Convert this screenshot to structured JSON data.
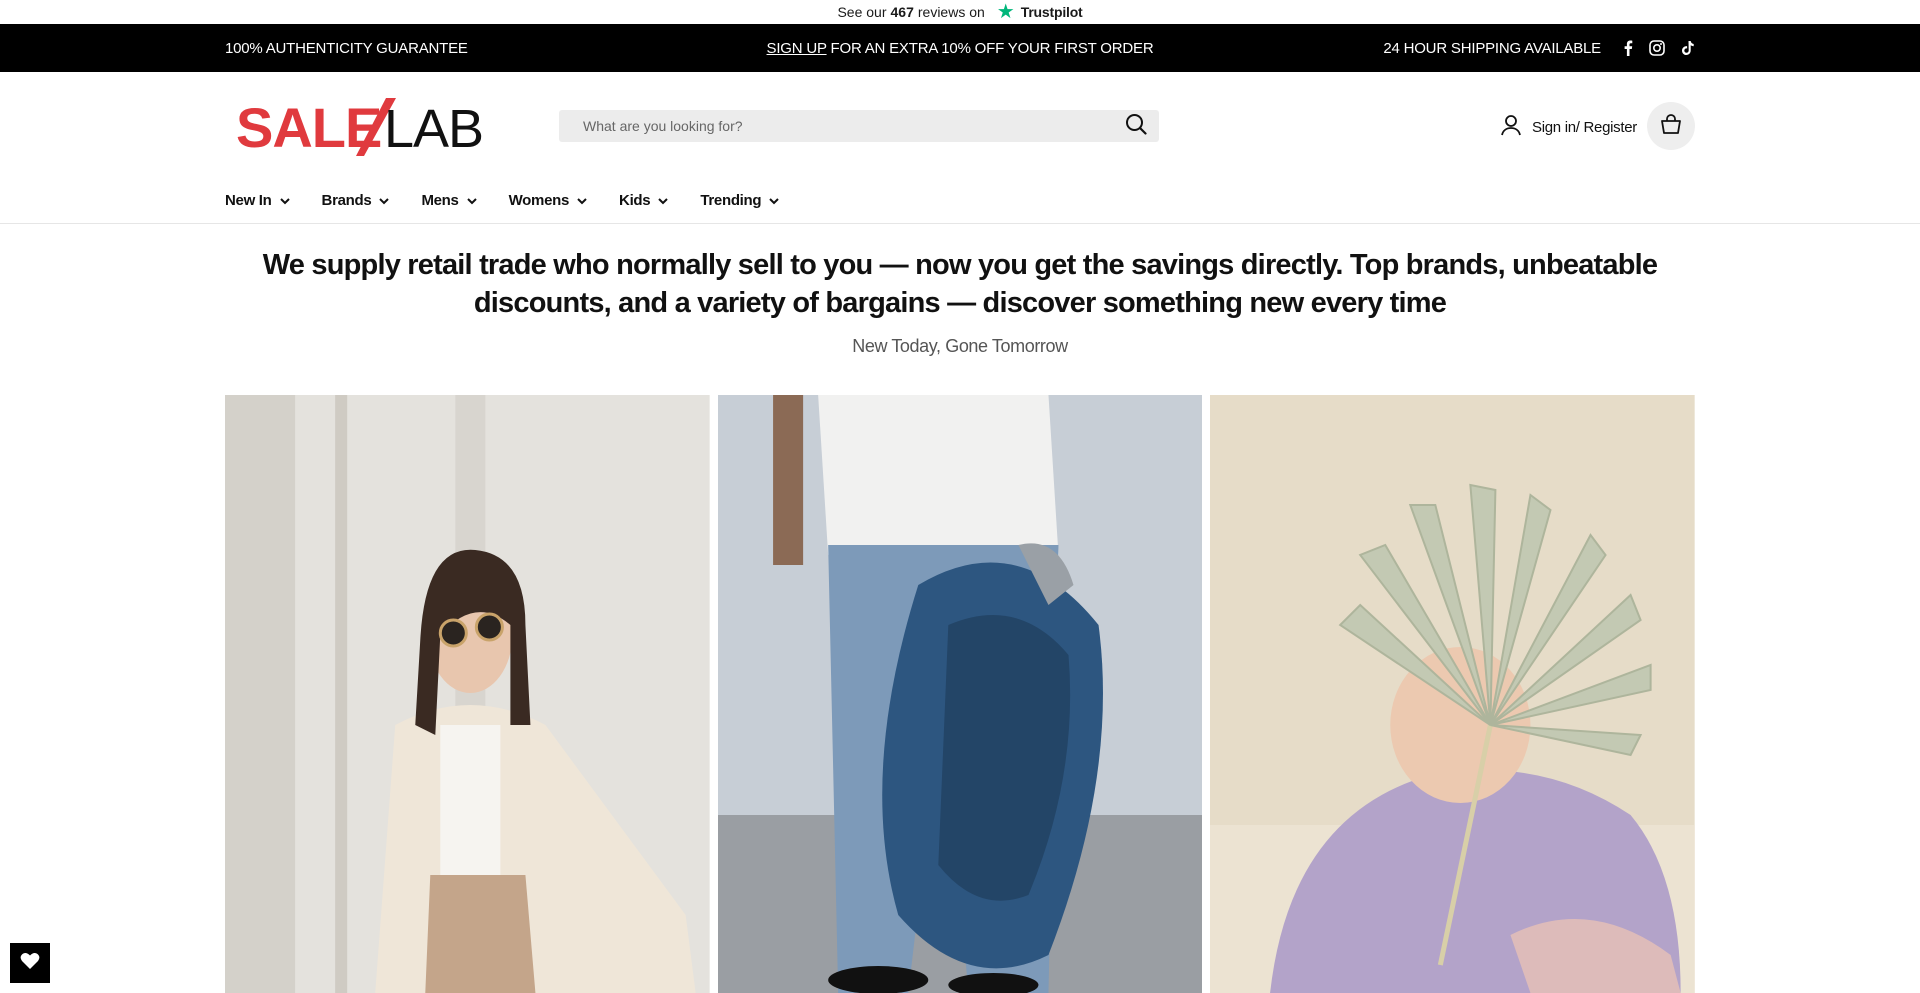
{
  "trustpilot": {
    "prefix": "See our",
    "count": "467",
    "suffix": "reviews on",
    "brand": "Trustpilot",
    "star_color": "#00b67a"
  },
  "announcement": {
    "left": "100% AUTHENTICITY GUARANTEE",
    "signup_link": "SIGN UP",
    "center_rest": " FOR AN EXTRA 10% OFF YOUR FIRST ORDER",
    "right": "24 HOUR SHIPPING AVAILABLE",
    "social": [
      "facebook-icon",
      "instagram-icon",
      "tiktok-icon"
    ]
  },
  "header": {
    "logo_sale": "SALE",
    "logo_lab": "LAB",
    "brand_color": "#e03a3e",
    "search_placeholder": "What are you looking for?",
    "account_label": "Sign in/ Register"
  },
  "nav": {
    "items": [
      {
        "label": "New In"
      },
      {
        "label": "Brands"
      },
      {
        "label": "Mens"
      },
      {
        "label": "Womens"
      },
      {
        "label": "Kids"
      },
      {
        "label": "Trending"
      }
    ]
  },
  "hero": {
    "headline": "We supply retail trade who normally sell to you — now you get the savings directly. Top brands, unbeatable discounts, and a variety of bargains — discover something new every time",
    "subline": "New Today, Gone Tomorrow"
  },
  "tiles": [
    {
      "name": "womens-tile"
    },
    {
      "name": "mens-tile"
    },
    {
      "name": "kids-tile"
    }
  ]
}
